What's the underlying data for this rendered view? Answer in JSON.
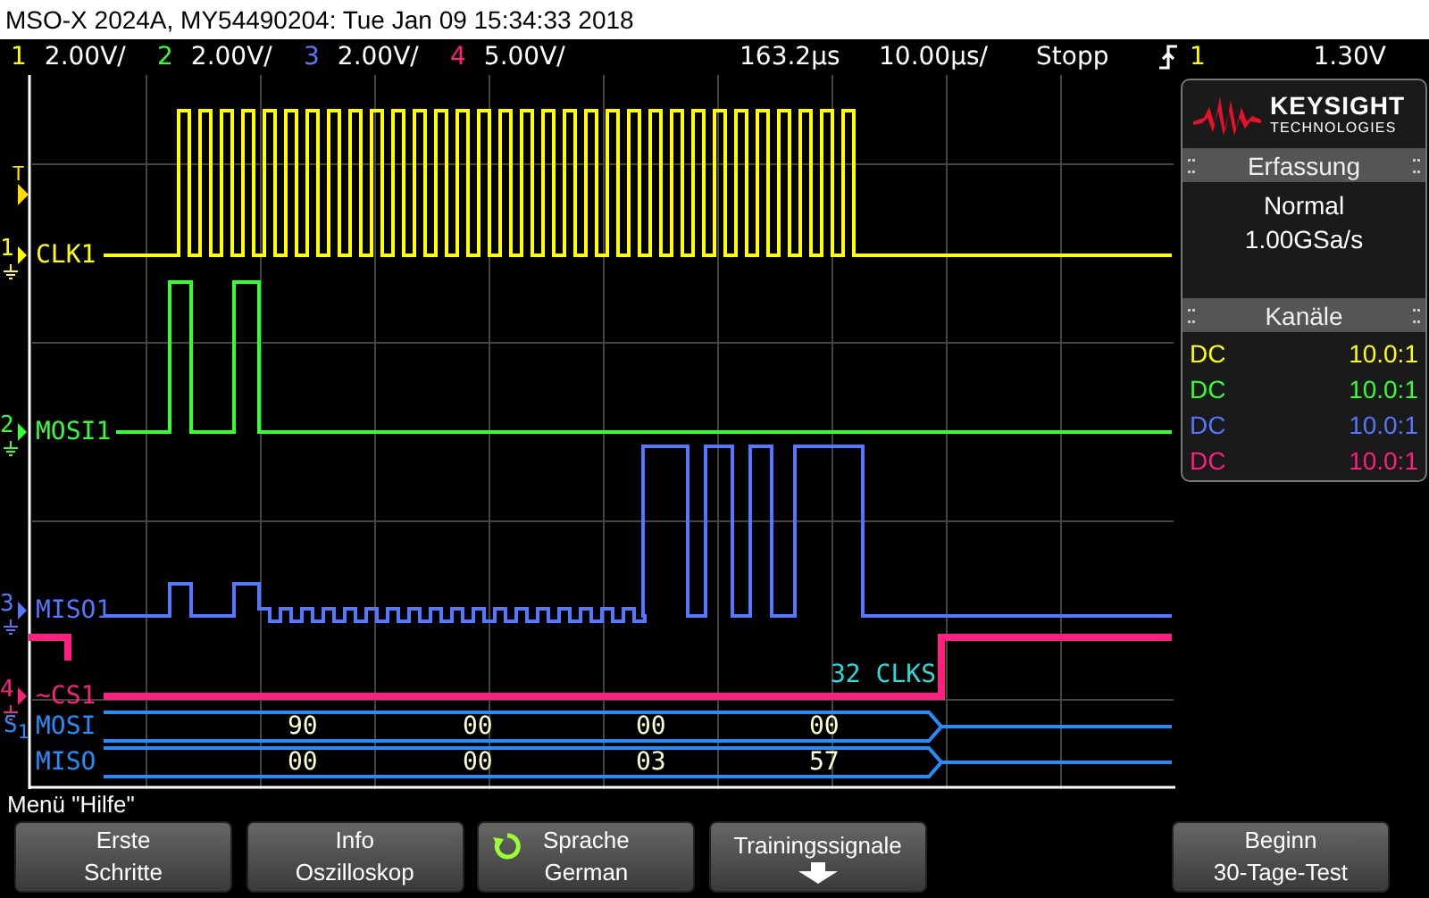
{
  "title": "MSO-X 2024A, MY54490204: Tue Jan 09 15:34:33 2018",
  "status": {
    "channels": [
      {
        "number": "1",
        "scale": "2.00V/",
        "color": "#ffff00"
      },
      {
        "number": "2",
        "scale": "2.00V/",
        "color": "#33ff33"
      },
      {
        "number": "3",
        "scale": "2.00V/",
        "color": "#5577ff"
      },
      {
        "number": "4",
        "scale": "5.00V/",
        "color": "#ff1f7f"
      }
    ],
    "delay": "163.2µs",
    "time_base": "10.00µs/",
    "run_state": "Stopp",
    "trigger_source": "1",
    "trigger_level": "1.30V"
  },
  "trigger_marker": "T",
  "serial_marker": "S$_{1}$",
  "traces": [
    {
      "number": "1",
      "label": "CLK1",
      "color": "#ffff00"
    },
    {
      "number": "2",
      "label": "MOSI1",
      "color": "#33ff33"
    },
    {
      "number": "3",
      "label": "MISO1",
      "color": "#5577ff"
    },
    {
      "number": "4",
      "label": "~CS1",
      "color": "#ff1f7f"
    }
  ],
  "bus": {
    "note": "32 CLKS",
    "rows": [
      {
        "name": "MOSI",
        "values": [
          "90",
          "00",
          "00",
          "00"
        ]
      },
      {
        "name": "MISO",
        "values": [
          "00",
          "00",
          "03",
          "57"
        ]
      }
    ]
  },
  "panel": {
    "logo": {
      "name": "KEYSIGHT",
      "subtitle": "TECHNOLOGIES"
    },
    "acquisition": {
      "title": "Erfassung",
      "mode": "Normal",
      "rate": "1.00GSa/s"
    },
    "channels": {
      "title": "Kanäle",
      "rows": [
        {
          "coupling": "DC",
          "probe": "10.0:1",
          "color": "#ffff00"
        },
        {
          "coupling": "DC",
          "probe": "10.0:1",
          "color": "#33ff33"
        },
        {
          "coupling": "DC",
          "probe": "10.0:1",
          "color": "#5577ff"
        },
        {
          "coupling": "DC",
          "probe": "10.0:1",
          "color": "#ff1f7f"
        }
      ]
    }
  },
  "menu": {
    "title": "Menü \"Hilfe\"",
    "softkeys": [
      {
        "kind": "key",
        "lines": [
          "Erste",
          "Schritte"
        ]
      },
      {
        "kind": "key",
        "lines": [
          "Info",
          "Oszilloskop"
        ]
      },
      {
        "kind": "cycle",
        "lines": [
          "Sprache",
          "German"
        ]
      },
      {
        "kind": "down",
        "lines": [
          "Trainingssignale"
        ]
      },
      {
        "kind": "empty"
      },
      {
        "kind": "key",
        "lines": [
          "Beginn",
          "30-Tage-Test"
        ]
      }
    ]
  }
}
